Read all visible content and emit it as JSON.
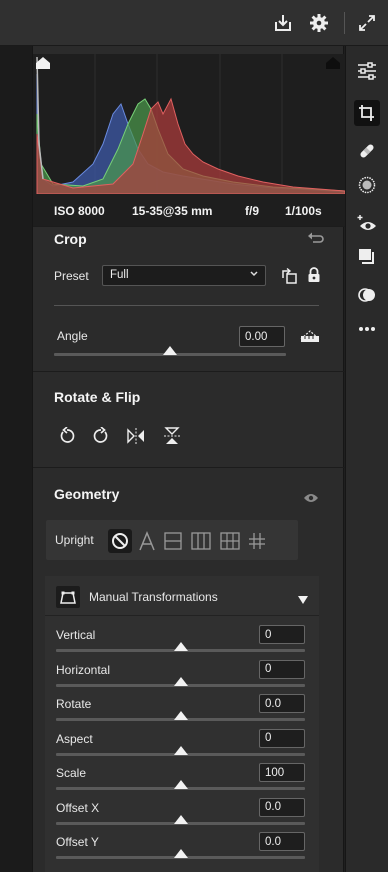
{
  "histogram": {
    "exif": {
      "iso": "ISO 8000",
      "lens": "15-35@35 mm",
      "aperture": "f/9",
      "shutter": "1/100s"
    }
  },
  "crop": {
    "title": "Crop",
    "preset_label": "Preset",
    "preset_value": "Full",
    "angle_label": "Angle",
    "angle_value": "0.00",
    "angle_fraction": 0.5
  },
  "rotate_flip": {
    "title": "Rotate & Flip"
  },
  "geometry": {
    "title": "Geometry",
    "upright_label": "Upright",
    "manual_title": "Manual Transformations",
    "sliders": [
      {
        "label": "Vertical",
        "value": "0",
        "fraction": 0.5
      },
      {
        "label": "Horizontal",
        "value": "0",
        "fraction": 0.5
      },
      {
        "label": "Rotate",
        "value": "0.0",
        "fraction": 0.5
      },
      {
        "label": "Aspect",
        "value": "0",
        "fraction": 0.5
      },
      {
        "label": "Scale",
        "value": "100",
        "fraction": 0.5
      },
      {
        "label": "Offset X",
        "value": "0.0",
        "fraction": 0.5
      },
      {
        "label": "Offset Y",
        "value": "0.0",
        "fraction": 0.5
      }
    ]
  },
  "colors": {
    "histogram_red": "#d84a4a",
    "histogram_green": "#5cc65c",
    "histogram_blue": "#4a72d8",
    "histogram_yellow": "#c8c040"
  },
  "icons": {
    "topbar": [
      "export-icon",
      "gear-icon",
      "fullscreen-icon"
    ],
    "rightbar": [
      "adjust-sliders-icon",
      "crop-tool-icon",
      "healing-brush-icon",
      "radial-mask-icon",
      "red-eye-icon",
      "presets-icon",
      "masking-icon",
      "more-icon"
    ]
  }
}
